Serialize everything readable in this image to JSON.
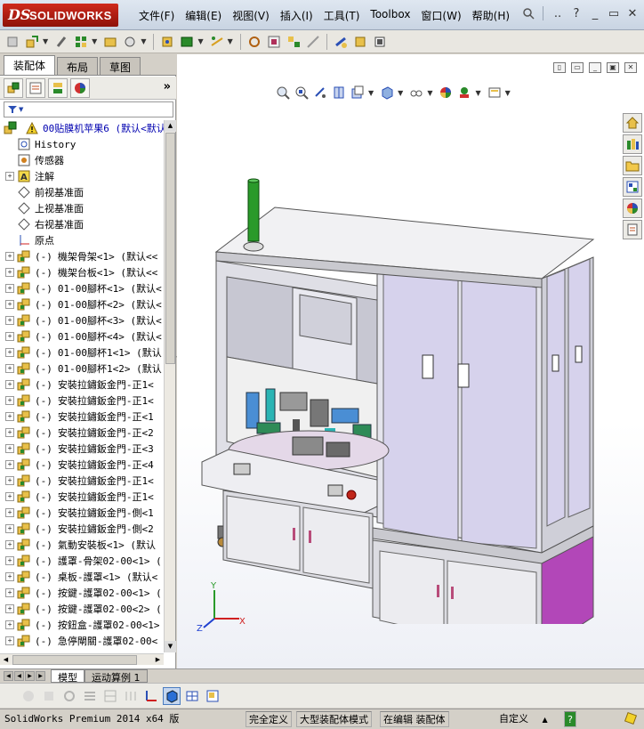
{
  "app": {
    "logo_ds": "DS",
    "logo_text": "SOLIDWORKS"
  },
  "menu": [
    "文件(F)",
    "编辑(E)",
    "视图(V)",
    "插入(I)",
    "工具(T)",
    "Toolbox",
    "窗口(W)",
    "帮助(H)"
  ],
  "window_controls": {
    "more": "..",
    "help": "?",
    "minimize": "_",
    "restore": "▭",
    "close": "✕"
  },
  "left_tabs": [
    "装配体",
    "布局",
    "草图"
  ],
  "fm_more": "»",
  "filter_label": "▼",
  "tree": {
    "root": "00贴膜机苹果6  (默认<默认",
    "children": [
      {
        "label": "History",
        "icon": "history-icon",
        "expand": false
      },
      {
        "label": "传感器",
        "icon": "sensor-icon",
        "expand": false
      },
      {
        "label": "注解",
        "icon": "annotation-icon",
        "expand": true
      },
      {
        "label": "前视基准面",
        "icon": "plane-icon",
        "expand": false
      },
      {
        "label": "上视基准面",
        "icon": "plane-icon",
        "expand": false
      },
      {
        "label": "右视基准面",
        "icon": "plane-icon",
        "expand": false
      },
      {
        "label": "原点",
        "icon": "origin-icon",
        "expand": false
      }
    ],
    "components": [
      "機架骨架<1> (默认<<",
      "機架台板<1> (默认<<",
      "01-00腳杯<1> (默认<",
      "01-00腳杯<2> (默认<",
      "01-00腳杯<3> (默认<",
      "01-00腳杯<4> (默认<",
      "01-00腳杯1<1> (默认",
      "01-00腳杯1<2> (默认",
      "安裝拉鏽鈑金門-正1<",
      "安裝拉鏽鈑金門-正1<",
      "安裝拉鏽鈑金門-正<1",
      "安裝拉鏽鈑金門-正<2",
      "安裝拉鏽鈑金門-正<3",
      "安裝拉鏽鈑金門-正<4",
      "安裝拉鏽鈑金門-正1<",
      "安裝拉鏽鈑金門-正1<",
      "安裝拉鏽鈑金門-側<1",
      "安裝拉鏽鈑金門-側<2",
      "氣動安裝板<1> (默认",
      "護罩-骨架02-00<1> (",
      "桌板-護罩<1> (默认<",
      "按鍵-護罩02-00<1> (",
      "按鍵-護罩02-00<2> (",
      "按鈕盒-護罩02-00<1>",
      "急停閘關-護罩02-00<"
    ],
    "component_prefix": "(-)"
  },
  "bottom_tabs": [
    "模型",
    "运动算例 1"
  ],
  "status": {
    "product": "SolidWorks Premium 2014 x64 版",
    "fully_defined": "完全定义",
    "large_assembly": "大型装配体模式",
    "editing": "在编辑 装配体",
    "units": "自定义",
    "units_arrow": "▲",
    "help": "?"
  },
  "triad": {
    "x": "X",
    "y": "Y",
    "z": "Z"
  },
  "colors": {
    "accent_red": "#c0251a",
    "purple_panel": "#b247b8",
    "green_light": "#2a9a2a"
  }
}
